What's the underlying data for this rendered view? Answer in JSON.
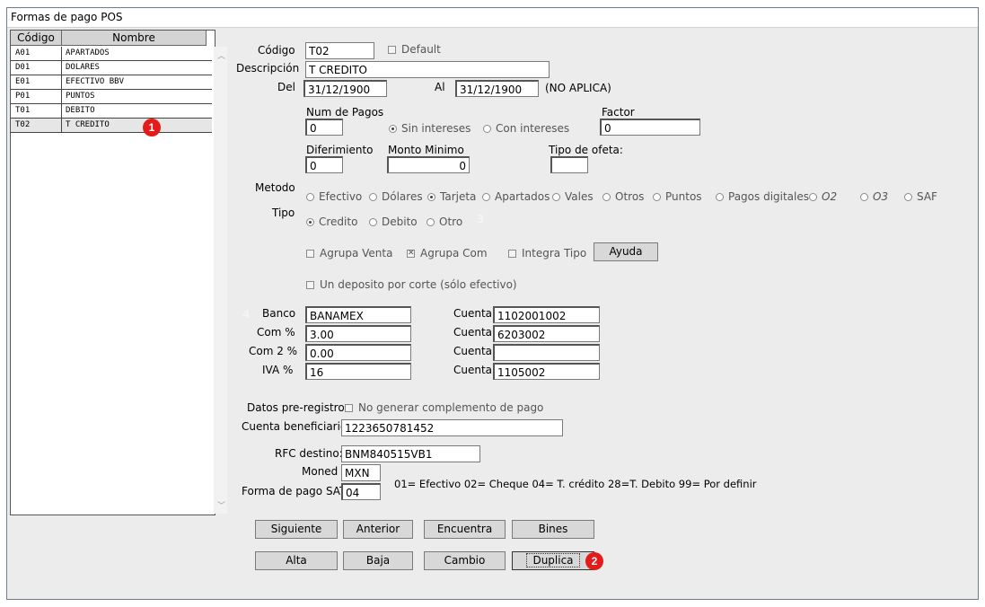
{
  "window": {
    "title": "Formas de pago POS"
  },
  "list": {
    "col_code": "Código",
    "col_name": "Nombre",
    "rows": [
      {
        "code": "A01",
        "name": "APARTADOS"
      },
      {
        "code": "D01",
        "name": "DOLARES"
      },
      {
        "code": "E01",
        "name": "EFECTIVO BBV"
      },
      {
        "code": "P01",
        "name": "PUNTOS"
      },
      {
        "code": "T01",
        "name": "DEBITO"
      },
      {
        "code": "T02",
        "name": "T CREDITO"
      }
    ],
    "selected_index": 5
  },
  "form": {
    "codigo_label": "Código",
    "codigo_value": "T02",
    "default_label": "Default",
    "descripcion_label": "Descripción",
    "descripcion_value": "T CREDITO",
    "del_label": "Del",
    "del_value": "31/12/1900",
    "al_label": "Al",
    "al_value": "31/12/1900",
    "no_aplica": "(NO APLICA)",
    "num_pagos_label": "Num de Pagos",
    "num_pagos_value": "0",
    "sin_intereses": "Sin intereses",
    "con_intereses": "Con intereses",
    "factor_label": "Factor",
    "factor_value": "0",
    "diferimiento_label": "Diferimiento",
    "diferimiento_value": "0",
    "monto_minimo_label": "Monto Minimo",
    "monto_minimo_value": "0",
    "tipo_oferta_label": "Tipo de ofeta:",
    "tipo_oferta_value": "",
    "metodo_label": "Metodo",
    "metodo_options": [
      "Efectivo",
      "Dólares",
      "Tarjeta",
      "Apartados",
      "Vales",
      "Otros",
      "Puntos",
      "Pagos digitales",
      "O2",
      "O3",
      "SAF"
    ],
    "metodo_selected": "Tarjeta",
    "tipo_label": "Tipo",
    "tipo_options": [
      "Credito",
      "Debito",
      "Otro"
    ],
    "tipo_selected": "Credito",
    "agrupa_venta": "Agrupa Venta",
    "agrupa_com": "Agrupa Com",
    "integra_tipo": "Integra Tipo",
    "ayuda": "Ayuda",
    "un_deposito": "Un deposito por corte (sólo efectivo)",
    "banco_label": "Banco",
    "banco_value": "BANAMEX",
    "com_label": "Com %",
    "com_value": "3.00",
    "com2_label": "Com 2 %",
    "com2_value": "0.00",
    "iva_label": "IVA %",
    "iva_value": "16",
    "cuenta_label": "Cuenta",
    "cuenta1_value": "1102001002",
    "cuenta2_value": "6203002",
    "cuenta3_value": "",
    "cuenta4_value": "1105002",
    "datos_pre_label": "Datos pre-registro:",
    "no_generar": "No generar complemento de pago",
    "cuenta_benef_label": "Cuenta beneficiario:",
    "cuenta_benef_value": "1223650781452",
    "rfc_label": "RFC destino:",
    "rfc_value": "BNM840515VB1",
    "moned_label": "Moned",
    "moned_value": "MXN",
    "forma_sat_label": "Forma de pago SAT:",
    "forma_sat_value": "04",
    "sat_legend": "01= Efectivo   02= Cheque  04= T. crédito  28=T. Debito  99= Por definir"
  },
  "buttons": {
    "siguiente": "Siguiente",
    "anterior": "Anterior",
    "encuentra": "Encuentra",
    "bines": "Bines",
    "alta": "Alta",
    "baja": "Baja",
    "cambio": "Cambio",
    "duplica": "Duplica"
  },
  "annotations": {
    "b1": "1",
    "b2": "2",
    "b3": "3",
    "b4": "4"
  }
}
